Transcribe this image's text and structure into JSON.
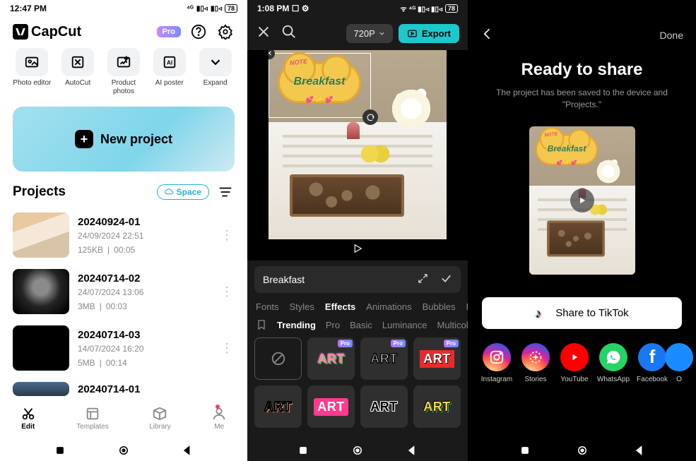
{
  "status": {
    "time1": "12:47 PM",
    "time2": "1:08 PM",
    "battery": "78"
  },
  "p1": {
    "app_name": "CapCut",
    "pro": "Pro",
    "tools": [
      {
        "label": "Photo editor"
      },
      {
        "label": "AutoCut"
      },
      {
        "label": "Product\nphotos"
      },
      {
        "label": "AI poster"
      },
      {
        "label": "Expand"
      }
    ],
    "new_project": "New project",
    "projects_title": "Projects",
    "space": "Space",
    "projects": [
      {
        "name": "20240924-01",
        "date": "24/09/2024 22:51",
        "size": "125KB",
        "dur": "00:05"
      },
      {
        "name": "20240714-02",
        "date": "24/07/2024 13:06",
        "size": "3MB",
        "dur": "00:03"
      },
      {
        "name": "20240714-03",
        "date": "14/07/2024 16:20",
        "size": "5MB",
        "dur": "00:14"
      },
      {
        "name": "20240714-01",
        "date": "",
        "size": "",
        "dur": ""
      }
    ],
    "tabs": [
      {
        "label": "Edit"
      },
      {
        "label": "Templates"
      },
      {
        "label": "Library"
      },
      {
        "label": "Me"
      }
    ]
  },
  "p2": {
    "resolution": "720P",
    "export": "Export",
    "sticker_note": "NOTE",
    "sticker_text": "Breakfast",
    "text_value": "Breakfast",
    "tabs": [
      "Fonts",
      "Styles",
      "Effects",
      "Animations",
      "Bubbles",
      "P"
    ],
    "active_tab": "Effects",
    "subtabs": [
      "Trending",
      "Pro",
      "Basic",
      "Luminance",
      "Multicol"
    ],
    "active_sub": "Trending",
    "fx_pro": "Pro",
    "fx_label": "ART"
  },
  "p3": {
    "done": "Done",
    "title": "Ready to share",
    "subtitle": "The project has been saved to the device and \"Projects.\"",
    "share_tiktok": "Share to TikTok",
    "targets": [
      {
        "label": "Instagram"
      },
      {
        "label": "Stories"
      },
      {
        "label": "YouTube"
      },
      {
        "label": "WhatsApp"
      },
      {
        "label": "Facebook"
      },
      {
        "label": "O"
      }
    ]
  }
}
